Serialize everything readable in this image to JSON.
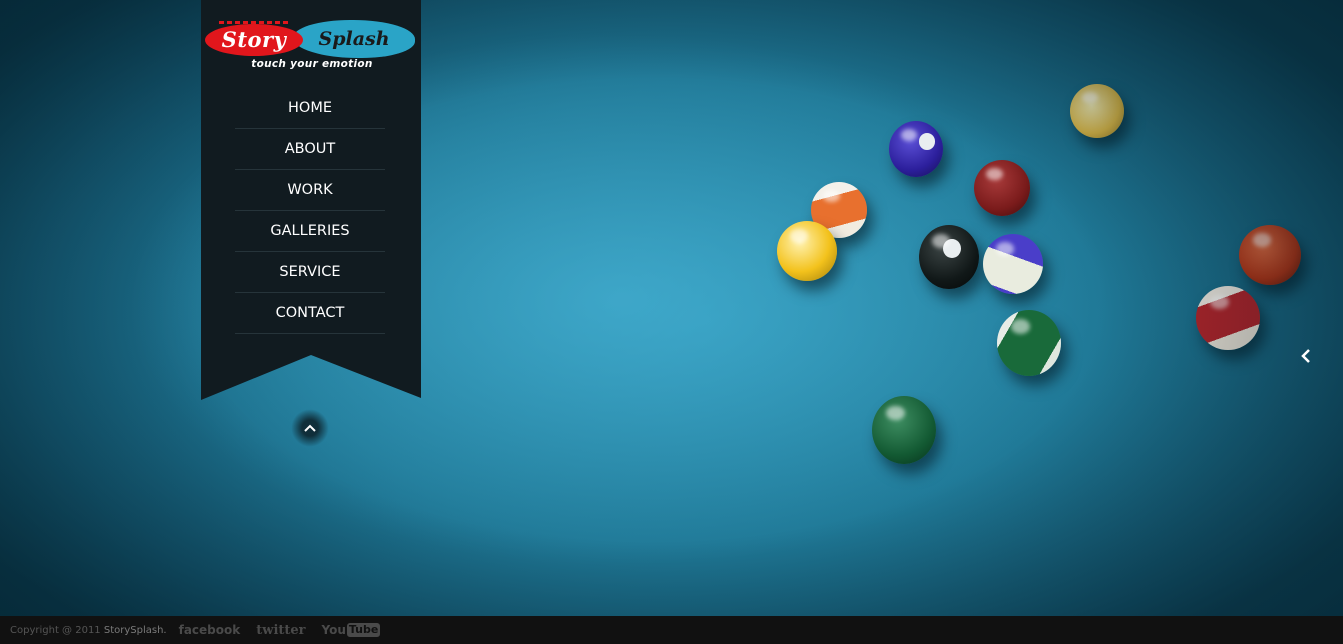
{
  "logo": {
    "word_story": "Story",
    "word_splash": "Splash",
    "tagline": "touch your emotion"
  },
  "nav": {
    "items": [
      "HOME",
      "ABOUT",
      "WORK",
      "GALLERIES",
      "SERVICE",
      "CONTACT"
    ]
  },
  "controls": {
    "scroll_up_icon": "chevron-up-icon",
    "prev_slide_icon": "chevron-left-icon"
  },
  "footer": {
    "copyright": "Copyright @ 2011",
    "brand": "StorySplash.",
    "social": {
      "facebook": "facebook",
      "twitter": "twitter",
      "youtube_you": "You",
      "youtube_tube": "Tube"
    }
  },
  "colors": {
    "menu_bg": "#111b20",
    "felt": "#1f7896",
    "logo_red": "#e1161c",
    "logo_blue": "#2aa4c7",
    "footer_bg": "#111111"
  }
}
